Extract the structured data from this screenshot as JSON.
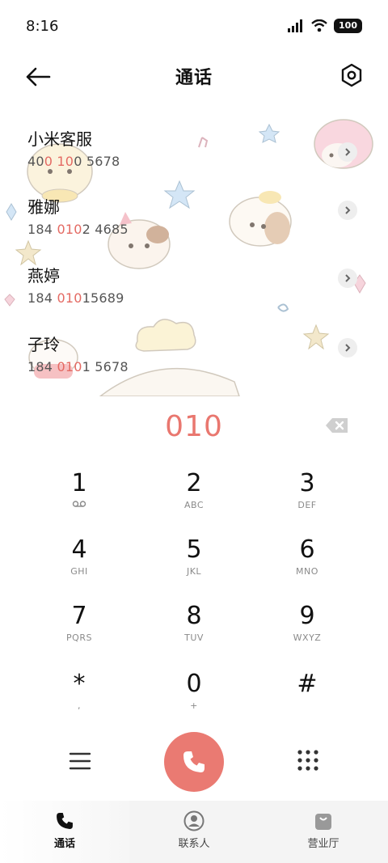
{
  "status_bar": {
    "time": "8:16",
    "battery": "100"
  },
  "header": {
    "title": "通话"
  },
  "contacts": [
    {
      "name": "小米客服",
      "number_parts": [
        "40",
        "0 10",
        "0 5678"
      ]
    },
    {
      "name": "雅娜",
      "number_parts": [
        "184 ",
        "010",
        "2 4685"
      ]
    },
    {
      "name": "燕婷",
      "number_parts": [
        "184 ",
        "010",
        "15689"
      ]
    },
    {
      "name": "子玲",
      "number_parts": [
        "184 ",
        "010",
        "1 5678"
      ]
    }
  ],
  "dialer": {
    "number": "010"
  },
  "keypad": [
    {
      "digit": "1",
      "letters": ""
    },
    {
      "digit": "2",
      "letters": "ABC"
    },
    {
      "digit": "3",
      "letters": "DEF"
    },
    {
      "digit": "4",
      "letters": "GHI"
    },
    {
      "digit": "5",
      "letters": "JKL"
    },
    {
      "digit": "6",
      "letters": "MNO"
    },
    {
      "digit": "7",
      "letters": "PQRS"
    },
    {
      "digit": "8",
      "letters": "TUV"
    },
    {
      "digit": "9",
      "letters": "WXYZ"
    },
    {
      "digit": "*",
      "letters": ","
    },
    {
      "digit": "0",
      "letters": "+"
    },
    {
      "digit": "#",
      "letters": ""
    }
  ],
  "bottom_nav": [
    {
      "label": "通话",
      "icon": "phone-icon",
      "active": true
    },
    {
      "label": "联系人",
      "icon": "contacts-icon",
      "active": false
    },
    {
      "label": "营业厅",
      "icon": "store-bag-icon",
      "active": false
    }
  ],
  "colors": {
    "accent": "#e9776f",
    "call_button": "#ea7a72"
  }
}
